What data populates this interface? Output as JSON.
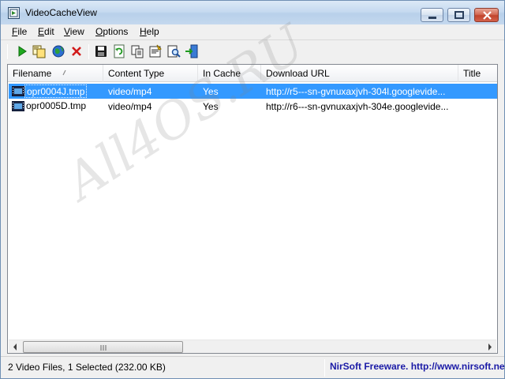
{
  "window": {
    "title": "VideoCacheView"
  },
  "menu": [
    {
      "label": "File",
      "key": "F",
      "rest": "ile"
    },
    {
      "label": "Edit",
      "key": "E",
      "rest": "dit"
    },
    {
      "label": "View",
      "key": "V",
      "rest": "iew"
    },
    {
      "label": "Options",
      "key": "O",
      "rest": "ptions"
    },
    {
      "label": "Help",
      "key": "H",
      "rest": "elp"
    }
  ],
  "toolbar_icons": [
    "play-icon",
    "copy-files-icon",
    "globe-icon",
    "delete-icon",
    "save-icon",
    "refresh-icon",
    "copy-icon",
    "properties-icon",
    "find-icon",
    "exit-icon"
  ],
  "table": {
    "columns": [
      "Filename",
      "Content Type",
      "In Cache",
      "Download URL",
      "Title"
    ],
    "rows": [
      {
        "filename": "opr0004J.tmp",
        "content_type": "video/mp4",
        "in_cache": "Yes",
        "download_url": "http://r5---sn-gvnuxaxjvh-304l.googlevide...",
        "title": "",
        "selected": true
      },
      {
        "filename": "opr0005D.tmp",
        "content_type": "video/mp4",
        "in_cache": "Yes",
        "download_url": "http://r6---sn-gvnuxaxjvh-304e.googlevide...",
        "title": "",
        "selected": false
      }
    ]
  },
  "status": {
    "summary": "2 Video Files, 1 Selected  (232.00 KB)",
    "credit": "NirSoft Freeware.  http://www.nirsoft.net"
  },
  "watermark": "All4OS.RU",
  "colors": {
    "selection": "#3399ff",
    "credit_text": "#1a1aa6"
  }
}
